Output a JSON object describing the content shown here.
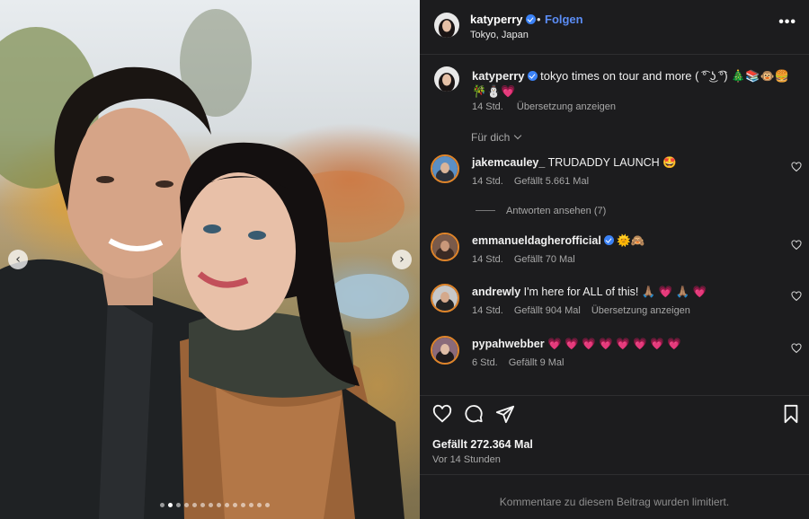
{
  "post": {
    "photo_alt_icon": "selfie-photo",
    "carousel": {
      "total_slides": 14,
      "active_index": 1
    }
  },
  "header": {
    "username": "katyperry",
    "dot": "•",
    "follow_label": "Folgen",
    "location": "Tokyo, Japan",
    "more_label": "•••"
  },
  "caption": {
    "username": "katyperry",
    "text": "tokyo times on tour and more ( ͡° ͜ʖ ͡°) 🎄📚🐵🍔🎋⛄💗",
    "time": "14 Std.",
    "translate": "Übersetzung anzeigen"
  },
  "filter": {
    "label": "Für dich"
  },
  "comments": [
    {
      "username": "jakemcauley_",
      "text": "TRUDADDY LAUNCH 🤩",
      "time": "14 Std.",
      "likes": "Gefällt 5.661 Mal",
      "verified": false
    },
    {
      "username": "emmanueldagherofficial",
      "text": "🌞🙈",
      "time": "14 Std.",
      "likes": "Gefällt 70 Mal",
      "verified": true
    },
    {
      "username": "andrewly",
      "text": "I'm here for ALL of this! 🙏🏽 💗 🙏🏽 💗",
      "time": "14 Std.",
      "likes": "Gefällt 904 Mal",
      "translate": "Übersetzung anzeigen",
      "verified": false
    },
    {
      "username": "pypahwebber",
      "text": "💗 💗 💗 💗 💗 💗 💗 💗",
      "time": "6 Std.",
      "likes": "Gefällt 9 Mal",
      "verified": false
    }
  ],
  "replies_label": "Antworten ansehen (7)",
  "footer": {
    "likes": "Gefällt 272.364 Mal",
    "time_ago": "Vor 14 Stunden",
    "limited": "Kommentare zu diesem Beitrag wurden limitiert."
  },
  "colors": {
    "accent": "#5b8df5",
    "verified": "#3b82f6",
    "panel_bg": "#1c1c1e",
    "heart_emoji": "#ff2d6f"
  }
}
